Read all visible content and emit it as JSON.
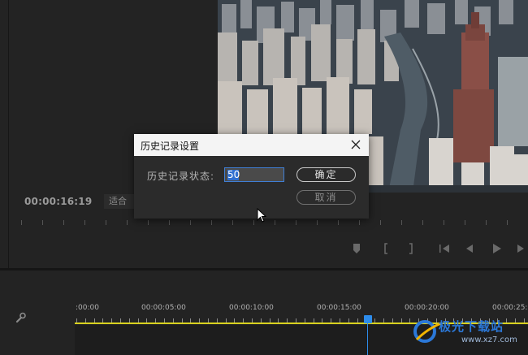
{
  "monitor": {
    "timecode": "00:00:16:19",
    "fit_label": "适合",
    "transport_icons": [
      "marker-icon",
      "in-point-icon",
      "out-point-icon",
      "go-to-in-icon",
      "step-back-icon",
      "play-icon",
      "step-forward-icon"
    ]
  },
  "timeline": {
    "ruler_labels": [
      ":00:00",
      "00:00:05:00",
      "00:00:10:00",
      "00:00:15:00",
      "00:00:20:00",
      "00:00:25:0"
    ],
    "work_area_color": "#d9d21f",
    "playhead_color": "#2d8ceb"
  },
  "dialog": {
    "title": "历史记录设置",
    "history_label": "历史记录状态:",
    "history_value": "50",
    "ok_label": "确定",
    "cancel_label": "取消"
  },
  "watermark": {
    "brand": "极光下载站",
    "url": "www.xz7.com"
  }
}
